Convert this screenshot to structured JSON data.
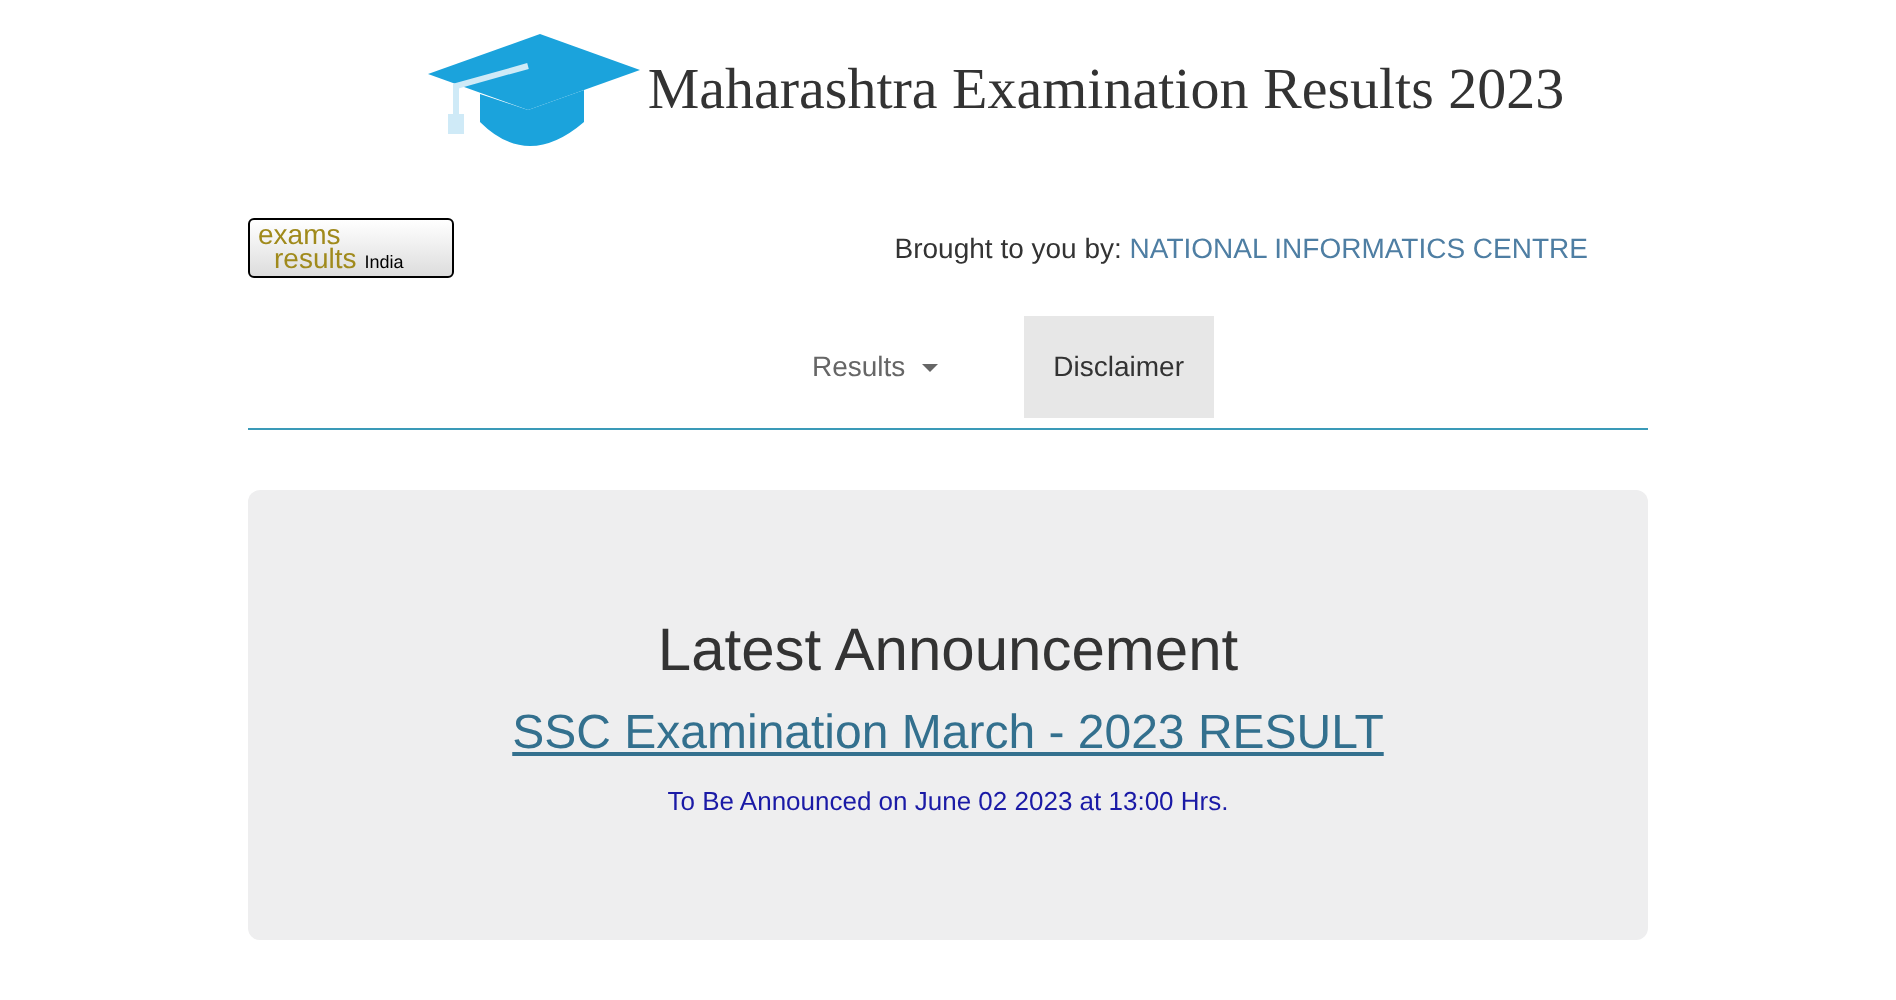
{
  "header": {
    "title": "Maharashtra Examination Results 2023"
  },
  "logo": {
    "line_1": "exams",
    "line_2": "results",
    "suffix": "India"
  },
  "credit": {
    "label": "Brought to you by:",
    "link": "NATIONAL INFORMATICS CENTRE"
  },
  "nav": [
    {
      "label": "Results",
      "kind": "dropdown",
      "selected": false
    },
    {
      "label": "Disclaimer",
      "kind": "link",
      "selected": true
    }
  ],
  "announcement": {
    "heading": "Latest Announcement",
    "link": "SSC Examination March - 2023 RESULT",
    "note": "To Be Announced on June 02 2023 at 13:00 Hrs."
  }
}
